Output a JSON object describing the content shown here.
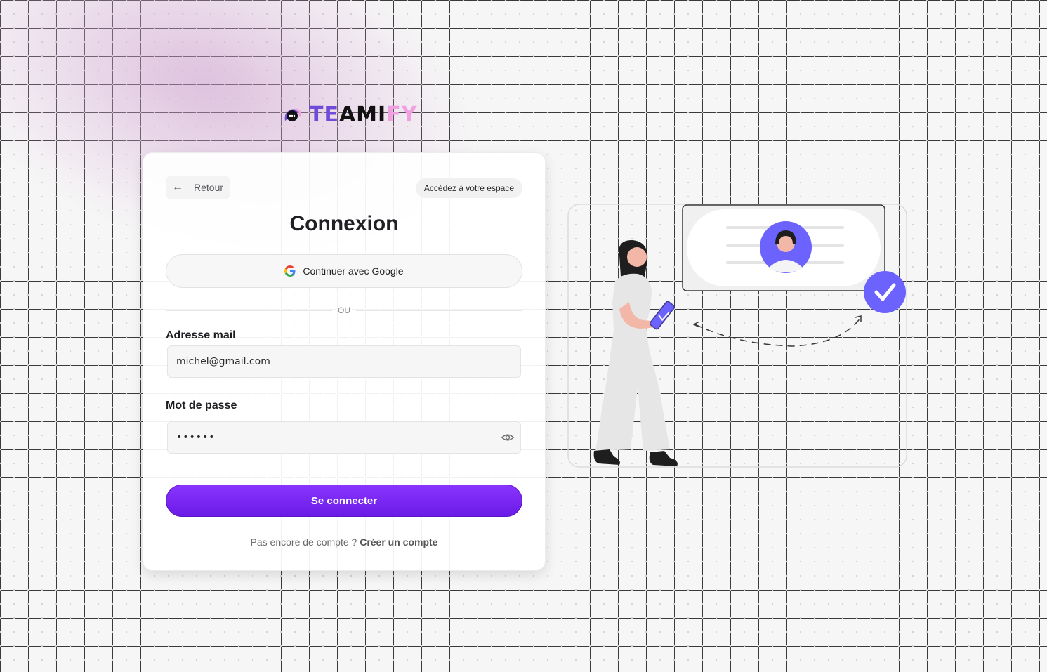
{
  "brand": {
    "name_part1": "TE",
    "name_part2": "AMI",
    "name_part3": "FY",
    "colors": {
      "primary": "#6e4bd8",
      "accent": "#f0a0e0",
      "button": "#7a26f5"
    }
  },
  "header": {
    "back_label": "Retour",
    "back_icon": "arrow-left-icon",
    "space_label": "Accédez à votre espace"
  },
  "form": {
    "title": "Connexion",
    "google_label": "Continuer avec Google",
    "divider_label": "OU",
    "email": {
      "label": "Adresse mail",
      "value": "michel@gmail.com"
    },
    "password": {
      "label": "Mot de passe",
      "value": "••••••",
      "toggle_icon": "eye-icon"
    },
    "submit_label": "Se connecter",
    "signup_prompt": "Pas encore de compte ?",
    "signup_link": "Créer un compte"
  }
}
